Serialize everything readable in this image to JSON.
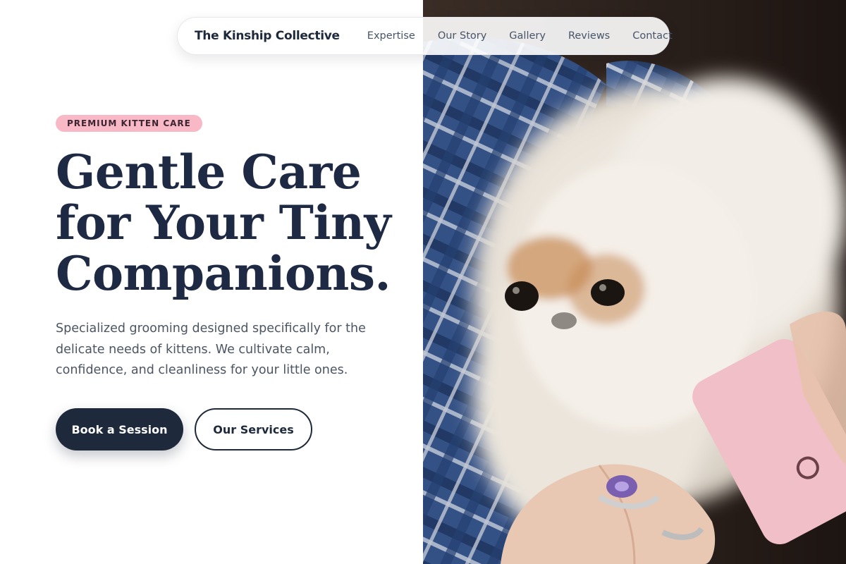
{
  "nav": {
    "brand": "The Kinship Collective",
    "links": [
      "Expertise",
      "Our Story",
      "Gallery",
      "Reviews",
      "Contact"
    ]
  },
  "hero": {
    "badge": "PREMIUM KITTEN CARE",
    "headline": [
      "Gentle Care",
      "for Your Tiny",
      "Companions."
    ],
    "lede": "Specialized grooming designed specifically for the delicate needs of kittens. We cultivate calm, confidence, and cleanliness for your little ones.",
    "primary_cta": "Book a Session",
    "secondary_cta": "Our Services",
    "photo_alt": "Fluffy white puppy wrapped in a blue plaid blanket held by a hand with rings"
  },
  "colors": {
    "navy": "#1e293b",
    "badge_pink": "#f9b8c6",
    "text_muted": "#4b5563"
  }
}
